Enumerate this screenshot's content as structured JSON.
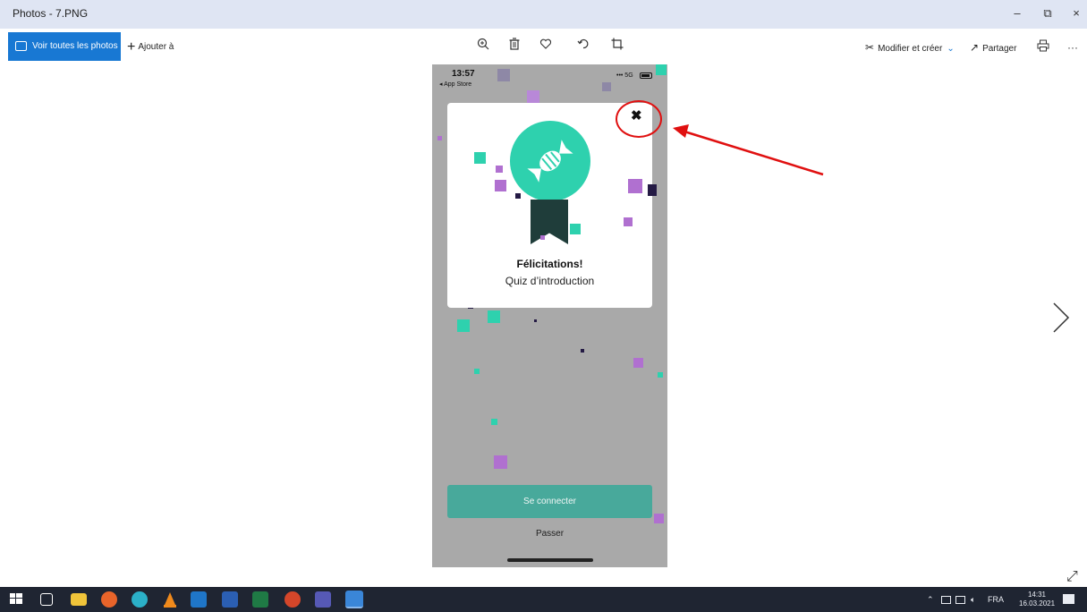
{
  "window": {
    "title": "Photos - 7.PNG",
    "minimize_glyph": "–",
    "restore_glyph": "⧉",
    "close_glyph": "×"
  },
  "toolbar": {
    "all_photos_label": "Voir toutes les photos",
    "add_to_label": "Ajouter à",
    "edit_create_label": "Modifier et créer",
    "share_label": "Partager",
    "more_label": "···",
    "icons": [
      "zoom-icon",
      "delete-icon",
      "favorite-icon",
      "rotate-icon",
      "crop-icon",
      "print-icon"
    ]
  },
  "phone": {
    "time": "13:57",
    "back_label": "◂ App Store",
    "network": "5G",
    "popup": {
      "close_glyph": "✖",
      "title": "Félicitations!",
      "subtitle": "Quiz d’introduction"
    },
    "connect_button": "Se connecter",
    "skip_label": "Passer"
  },
  "taskbar": {
    "language": "FRA",
    "time": "14:31",
    "date": "16.03.2021"
  },
  "colors": {
    "accent": "#1878d3",
    "teal": "#2ed1ae",
    "annotation_red": "#e01010"
  }
}
